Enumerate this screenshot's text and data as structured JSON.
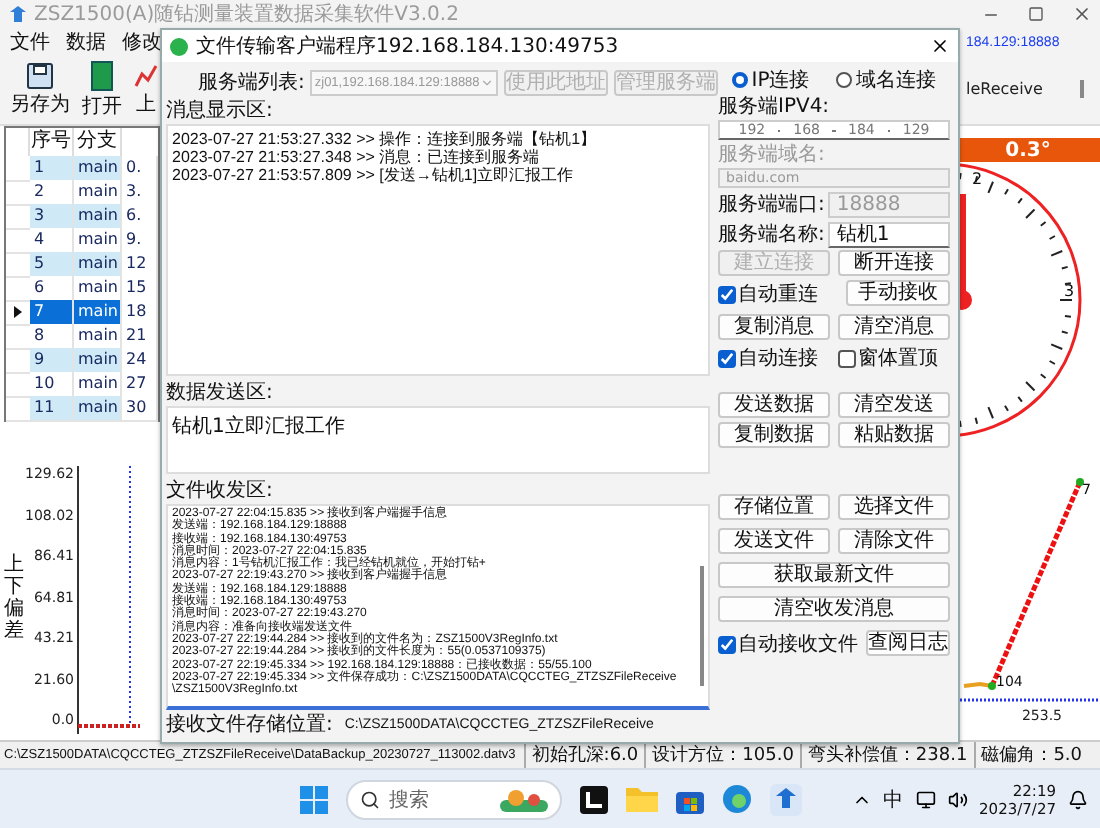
{
  "app": {
    "title": "ZSZ1500(A)随钻测量装置数据采集软件V3.0.2",
    "menu": [
      "文件",
      "数据",
      "修改"
    ],
    "toolbar": [
      "另存为",
      "打开",
      "上"
    ],
    "server_address": "184.129:18888",
    "receive_folder": "leReceive"
  },
  "table": {
    "columns": [
      "序号",
      "分支"
    ],
    "rows": [
      {
        "cells": [
          "1",
          "main",
          "0."
        ],
        "selected": false
      },
      {
        "cells": [
          "2",
          "main",
          "3."
        ],
        "selected": false
      },
      {
        "cells": [
          "3",
          "main",
          "6."
        ],
        "selected": false
      },
      {
        "cells": [
          "4",
          "main",
          "9."
        ],
        "selected": false
      },
      {
        "cells": [
          "5",
          "main",
          "12"
        ],
        "selected": false
      },
      {
        "cells": [
          "6",
          "main",
          "15"
        ],
        "selected": false
      },
      {
        "cells": [
          "7",
          "main",
          "18"
        ],
        "selected": true
      },
      {
        "cells": [
          "8",
          "main",
          "21"
        ],
        "selected": false
      },
      {
        "cells": [
          "9",
          "main",
          "24"
        ],
        "selected": false
      },
      {
        "cells": [
          "10",
          "main",
          "27"
        ],
        "selected": false
      },
      {
        "cells": [
          "11",
          "main",
          "30"
        ],
        "selected": false
      }
    ]
  },
  "left_chart": {
    "ylabel": "上下偏差",
    "yticks": [
      "129.62",
      "108.02",
      "86.41",
      "64.81",
      "43.21",
      "21.60",
      "0.0"
    ]
  },
  "gauge": {
    "reading": "0.3°",
    "labels": [
      "2",
      "3"
    ]
  },
  "right_chart": {
    "point_labels": [
      "7",
      "104"
    ],
    "xtick": "253.5"
  },
  "status_bar": {
    "path": "C:\\ZSZ1500DATA\\CQCCTEG_ZTZSZFileReceive\\DataBackup_20230727_113002.datv3",
    "cells": [
      "初始孔深:6.0",
      "设计方位：105.0",
      "弯头补偿值：238.1",
      "磁偏角：5.0"
    ]
  },
  "dialog": {
    "title": "文件传输客户端程序192.168.184.130:49753",
    "server_list_label": "服务端列表:",
    "server_list": "zj01,192.168.184.129:18888",
    "top_buttons": [
      {
        "label": "使用此地址",
        "disabled": true
      },
      {
        "label": "管理服务端",
        "disabled": true
      }
    ],
    "message_area": {
      "label": "消息显示区:",
      "lines": [
        "2023-07-27 21:53:27.332 >> 操作：连接到服务端【钻机1】",
        "2023-07-27 21:53:27.348 >> 消息：已连接到服务端",
        "2023-07-27 21:53:57.809 >> [发送→钻机1]立即汇报工作"
      ]
    },
    "send_area": {
      "label": "数据发送区:",
      "text": "钻机1立即汇报工作"
    },
    "file_area": {
      "label": "文件收发区:",
      "lines": [
        "2023-07-27 22:04:15.835 >> 接收到客户端握手信息",
        "发送端：192.168.184.129:18888",
        "接收端：192.168.184.130:49753",
        "消息时间：2023-07-27 22:04:15.835",
        "消息内容：1号钻机汇报工作：我已经钻机就位，开始打钻+",
        "2023-07-27 22:19:43.270 >> 接收到客户端握手信息",
        "发送端：192.168.184.129:18888",
        "接收端：192.168.184.130:49753",
        "消息时间：2023-07-27 22:19:43.270",
        "消息内容：准备向接收端发送文件",
        "2023-07-27 22:19:44.284 >> 接收到的文件名为：ZSZ1500V3RegInfo.txt",
        "2023-07-27 22:19:44.284 >> 接收到的文件长度为：55(0.0537109375)",
        "2023-07-27 22:19:45.334 >> 192.168.184.129:18888：已接收数据：55/55.100",
        "2023-07-27 22:19:45.334 >> 文件保存成功：C:\\ZSZ1500DATA\\CQCCTEG_ZTZSZFileReceive",
        "\\ZSZ1500V3RegInfo.txt"
      ]
    },
    "save_path": {
      "label": "接收文件存储位置:",
      "value": "C:\\ZSZ1500DATA\\CQCCTEG_ZTZSZFileReceive"
    },
    "connection_modes": [
      {
        "label": "IP连接",
        "selected": true
      },
      {
        "label": "域名连接",
        "selected": false
      }
    ],
    "fields": [
      {
        "kind": "ip",
        "label": "服务端IPV4:",
        "octets": [
          "192",
          "168",
          "184",
          "129"
        ],
        "disabled": false
      },
      {
        "kind": "text",
        "label": "服务端域名:",
        "value": "baidu.com",
        "disabled": true
      },
      {
        "kind": "inline",
        "label": "服务端端口:",
        "value": "18888",
        "disabled": true
      },
      {
        "kind": "inline",
        "label": "服务端名称:",
        "value": "钻机1",
        "disabled": false
      }
    ],
    "connection_controls": [
      {
        "kind": "button",
        "label": "建立连接",
        "disabled": true
      },
      {
        "kind": "button",
        "label": "断开连接",
        "disabled": false
      },
      {
        "kind": "checkbox",
        "label": "自动重连",
        "checked": true
      },
      {
        "kind": "button",
        "label": "手动接收",
        "disabled": false
      },
      {
        "kind": "button",
        "label": "复制消息",
        "disabled": false
      },
      {
        "kind": "button",
        "label": "清空消息",
        "disabled": false
      },
      {
        "kind": "checkbox",
        "label": "自动连接",
        "checked": true
      },
      {
        "kind": "checkbox",
        "label": "窗体置顶",
        "checked": false
      }
    ],
    "send_controls": [
      {
        "kind": "button",
        "label": "发送数据",
        "disabled": false
      },
      {
        "kind": "button",
        "label": "清空发送",
        "disabled": false
      },
      {
        "kind": "button",
        "label": "复制数据",
        "disabled": false
      },
      {
        "kind": "button",
        "label": "粘贴数据",
        "disabled": false
      }
    ],
    "file_controls": [
      {
        "kind": "button",
        "label": "存储位置",
        "disabled": false
      },
      {
        "kind": "button",
        "label": "选择文件",
        "disabled": false
      },
      {
        "kind": "button",
        "label": "发送文件",
        "disabled": false
      },
      {
        "kind": "button",
        "label": "清除文件",
        "disabled": false
      },
      {
        "kind": "wide_button",
        "label": "获取最新文件",
        "disabled": false
      },
      {
        "kind": "wide_button",
        "label": "清空收发消息",
        "disabled": false
      },
      {
        "kind": "checkbox",
        "label": "自动接收文件",
        "checked": true
      },
      {
        "kind": "button",
        "label": "查阅日志",
        "disabled": false
      }
    ]
  },
  "taskbar": {
    "search_placeholder": "搜索",
    "ime": "中",
    "time": "22:19",
    "date": "2023/7/27"
  }
}
